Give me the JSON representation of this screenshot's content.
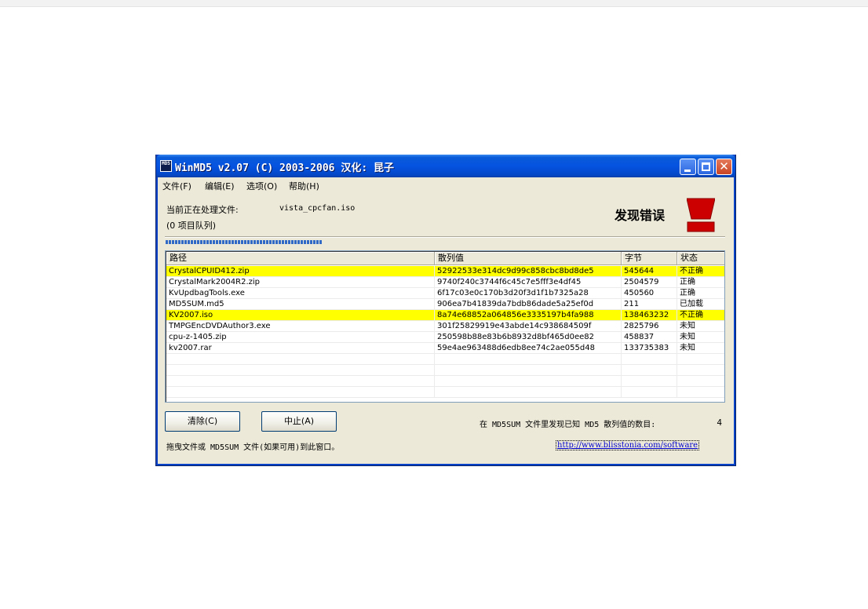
{
  "window": {
    "title": "WinMD5 v2.07 (C) 2003-2006  汉化: 昆子",
    "icon_text": "MD5"
  },
  "menu": [
    "文件(F)",
    "编辑(E)",
    "选项(O)",
    "帮助(H)"
  ],
  "processing": {
    "label": "当前正在处理文件:",
    "filename": "vista_cpcfan.iso",
    "queue": "(0 项目队列)"
  },
  "status": {
    "text": "发现错误",
    "icon": "error-stop-icon",
    "color": "#cc0000"
  },
  "table": {
    "headers": [
      "路径",
      "散列值",
      "字节",
      "状态"
    ],
    "rows": [
      {
        "path": "CrystalCPUID412.zip",
        "hash": "52922533e314dc9d99c858cbc8bd8de5",
        "bytes": "545644",
        "status": "不正确",
        "highlight": true
      },
      {
        "path": "CrystalMark2004R2.zip",
        "hash": "9740f240c3744f6c45c7e5fff3e4df45",
        "bytes": "2504579",
        "status": "正确",
        "highlight": false
      },
      {
        "path": "KvUpdbagTools.exe",
        "hash": "6f17c03e0c170b3d20f3d1f1b7325a28",
        "bytes": "450560",
        "status": "正确",
        "highlight": false
      },
      {
        "path": "MD5SUM.md5",
        "hash": "906ea7b41839da7bdb86dade5a25ef0d",
        "bytes": "211",
        "status": "已加载",
        "highlight": false
      },
      {
        "path": "KV2007.iso",
        "hash": "8a74e68852a064856e3335197b4fa988",
        "bytes": "138463232",
        "status": "不正确",
        "highlight": true
      },
      {
        "path": "TMPGEncDVDAuthor3.exe",
        "hash": "301f25829919e43abde14c938684509f",
        "bytes": "2825796",
        "status": "未知",
        "highlight": false
      },
      {
        "path": "cpu-z-1405.zip",
        "hash": "250598b88e83b6b8932d8bf465d0ee82",
        "bytes": "458837",
        "status": "未知",
        "highlight": false
      },
      {
        "path": "kv2007.rar",
        "hash": "59e4ae963488d6edb8ee74c2ae055d48",
        "bytes": "133735383",
        "status": "未知",
        "highlight": false
      }
    ],
    "highlight_color": "#ffff00"
  },
  "buttons": {
    "clear": "清除(C)",
    "stop": "中止(A)"
  },
  "footer": {
    "count_label": "在 MD5SUM 文件里发现已知 MD5 散列值的数目:",
    "count_value": "4",
    "hint": "拖曳文件或 MD5SUM 文件(如果可用)到此窗口。",
    "link": "http://www.blisstonia.com/software"
  }
}
